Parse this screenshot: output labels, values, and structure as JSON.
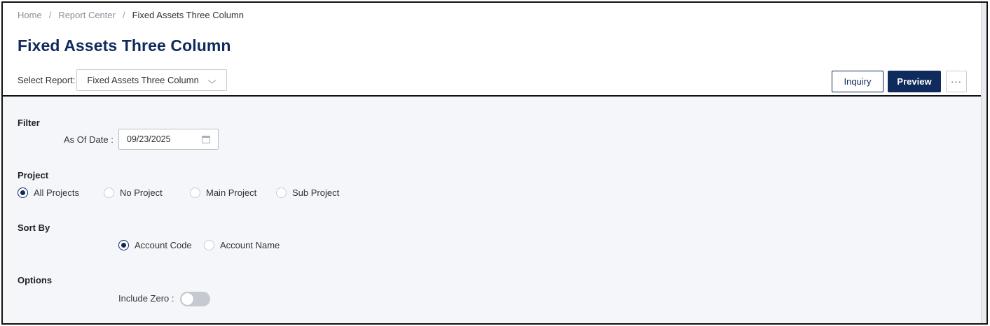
{
  "breadcrumb": {
    "items": [
      "Home",
      "Report Center",
      "Fixed Assets Three Column"
    ],
    "separator": "/"
  },
  "page": {
    "title": "Fixed Assets Three Column"
  },
  "report_select": {
    "label": "Select Report:",
    "value": "Fixed Assets Three Column",
    "chevron": "⌵"
  },
  "toolbar": {
    "inquiry_label": "Inquiry",
    "preview_label": "Preview",
    "more_label": "···"
  },
  "filter": {
    "title": "Filter",
    "as_of_date_label": "As Of Date :",
    "as_of_date_value": "09/23/2025"
  },
  "project": {
    "title": "Project",
    "options": [
      "All Projects",
      "No Project",
      "Main Project",
      "Sub Project"
    ],
    "selected": "All Projects"
  },
  "sort_by": {
    "title": "Sort By",
    "options": [
      "Account Code",
      "Account Name"
    ],
    "selected": "Account Code"
  },
  "options": {
    "title": "Options",
    "include_zero_label": "Include Zero :",
    "include_zero": false
  },
  "colors": {
    "primary": "#0f2a5c",
    "body_bg": "#f4f6fa",
    "toggle_off": "#c6c9cf"
  },
  "icons": {
    "date": "calendar-icon",
    "dropdown": "chevron-down-icon",
    "more": "more-horizontal-icon"
  }
}
